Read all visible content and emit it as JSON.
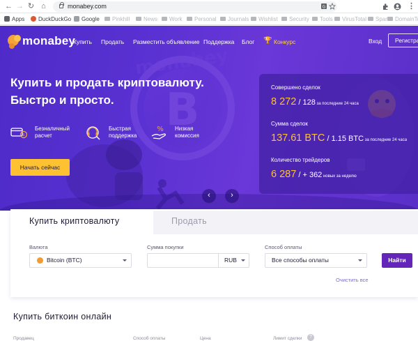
{
  "browser": {
    "url": "monabey.com",
    "bookmarks": [
      {
        "label": "Apps",
        "color": "#5f6368"
      },
      {
        "label": "DuckDuckGo",
        "color": "#de5833"
      },
      {
        "label": "Google",
        "color": "#9aa0a6"
      },
      {
        "label": "Pinkhill",
        "color": "#c9c9c9"
      },
      {
        "label": "News",
        "color": "#c9c9c9"
      },
      {
        "label": "Work",
        "color": "#c9c9c9"
      },
      {
        "label": "Personal",
        "color": "#c9c9c9"
      },
      {
        "label": "Journals",
        "color": "#c9c9c9"
      },
      {
        "label": "Wishlist",
        "color": "#c9c9c9"
      },
      {
        "label": "Security",
        "color": "#c9c9c9"
      },
      {
        "label": "Tools",
        "color": "#c9c9c9"
      },
      {
        "label": "VirusTotal",
        "color": "#c9c9c9"
      },
      {
        "label": "Spam",
        "color": "#c9c9c9"
      },
      {
        "label": "DomainTools - Wh...",
        "color": "#c9c9c9"
      }
    ]
  },
  "header": {
    "logo": "monabey",
    "nav": [
      "Купить",
      "Продать",
      "Разместить объявление",
      "Поддержка",
      "Блог"
    ],
    "contest": "Конкурс",
    "login": "Вход",
    "register": "Регистрация"
  },
  "hero": {
    "headline_1": "Купить и продать криптовалюту.",
    "headline_2": "Быстро и просто.",
    "features": [
      {
        "icon": "card-cash-icon",
        "line1": "Безналичный",
        "line2": "расчет"
      },
      {
        "icon": "support-headset-icon",
        "line1": "Быстрая",
        "line2": "поддержка"
      },
      {
        "icon": "percent-hand-icon",
        "line1": "Низкая",
        "line2": "комиссия"
      }
    ],
    "cta": "Начать сейчас",
    "prev": "‹",
    "next": "›"
  },
  "stats": {
    "deals_label": "Совершено сделок",
    "deals_value": "8 272",
    "deals_sep": " / ",
    "deals_recent": "128",
    "deals_suffix": " за последние 24 часа",
    "volume_label": "Сумма сделок",
    "volume_value": "137.61 BTC",
    "volume_sep": " / ",
    "volume_recent": "1.15 BTC",
    "volume_suffix": " за последние 24 часа",
    "traders_label": "Количество трейдеров",
    "traders_value": "6 287",
    "traders_sep": " / ",
    "traders_recent": "+ 362",
    "traders_suffix": " новых за неделю"
  },
  "search": {
    "tab_buy": "Купить криптовалюту",
    "tab_sell": "Продать",
    "currency_label": "Валюта",
    "currency_value": "Bitcoin (BTC)",
    "amount_label": "Сумма покупки",
    "amount_value": "",
    "amount_currency": "RUB",
    "payment_label": "Способ оплаты",
    "payment_value": "Все способы оплаты",
    "find": "Найти",
    "clear": "Очистить все"
  },
  "listing": {
    "title": "Купить биткоин онлайн",
    "columns": [
      "Продавец",
      "Способ оплаты",
      "Цена",
      "Лимит сделки"
    ]
  },
  "colors": {
    "brand_purple": "#5a31d2",
    "accent_yellow": "#fdc131",
    "button_purple": "#6326b9"
  }
}
